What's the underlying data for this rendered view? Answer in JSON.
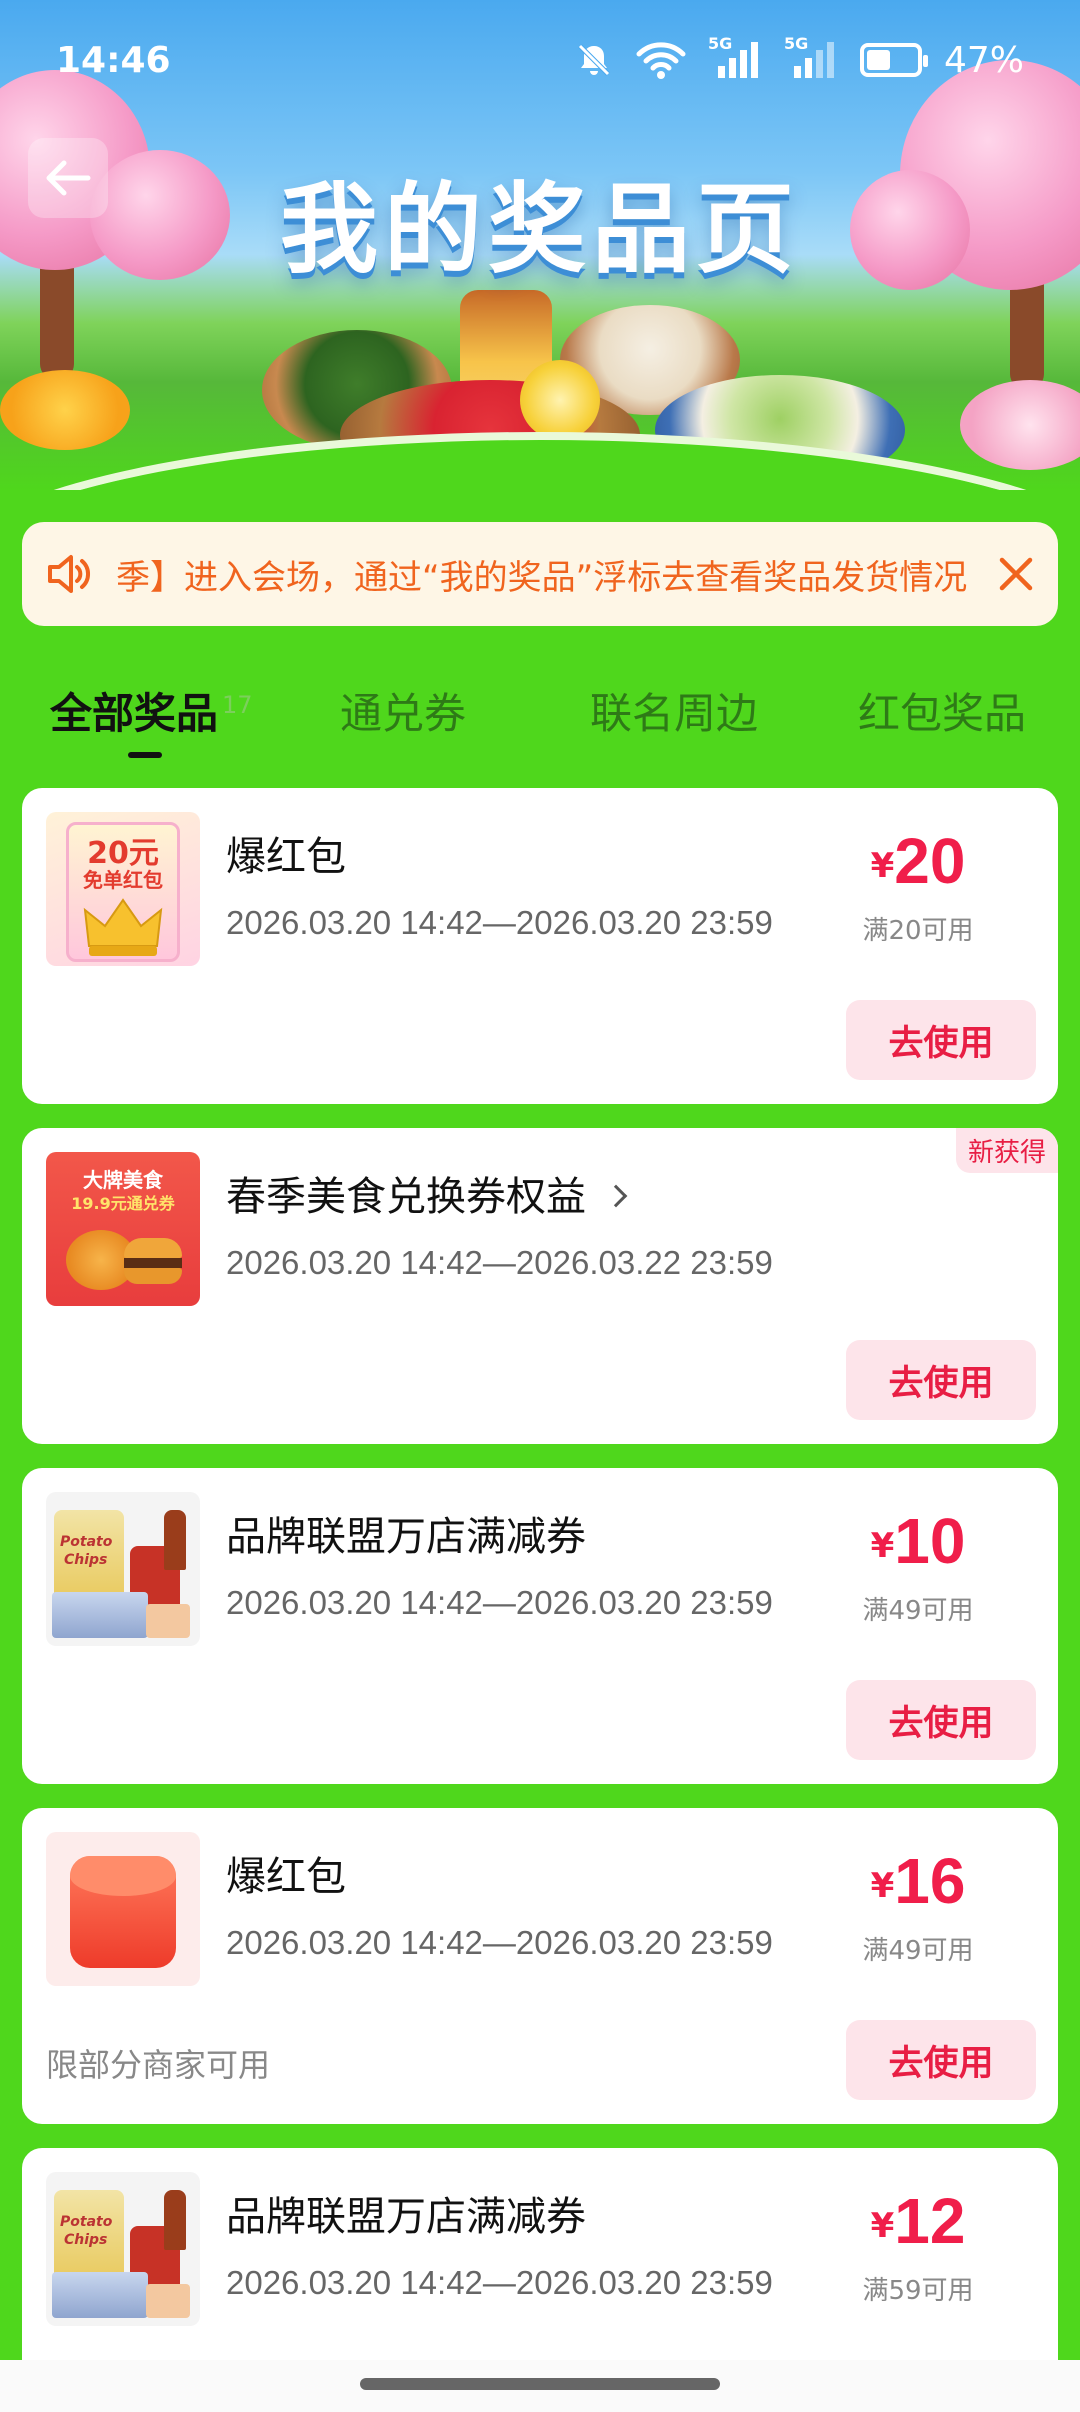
{
  "status_bar": {
    "time": "14:46",
    "network_1": "5G",
    "network_2": "5G",
    "battery": "47%",
    "battery_level": 0.47
  },
  "banner": {
    "title": "我的奖品页"
  },
  "notice": {
    "text": "季】进入会场，通过“我的奖品”浮标去查看奖品发货情况"
  },
  "tabs": [
    {
      "label": "全部奖品",
      "count": "17"
    },
    {
      "label": "通兑券"
    },
    {
      "label": "联名周边"
    },
    {
      "label": "红包奖品"
    }
  ],
  "prizes": [
    {
      "name": "爆红包",
      "date": "2026.03.20 14:42—2026.03.20 23:59",
      "yen": "¥",
      "amount": "20",
      "condition": "满20可用",
      "action": "去使用",
      "thumb_line1": "20元",
      "thumb_line2": "免单红包"
    },
    {
      "name": "春季美食兑换券权益",
      "date": "2026.03.20 14:42—2026.03.22 23:59",
      "tag": "新获得",
      "action": "去使用",
      "thumb_line1": "大牌美食",
      "thumb_line2": "19.9元通兑券"
    },
    {
      "name": "品牌联盟万店满减券",
      "date": "2026.03.20 14:42—2026.03.20 23:59",
      "yen": "¥",
      "amount": "10",
      "condition": "满49可用",
      "action": "去使用",
      "thumb_line1": "Potato",
      "thumb_line2": "Chips"
    },
    {
      "name": "爆红包",
      "date": "2026.03.20 14:42—2026.03.20 23:59",
      "yen": "¥",
      "amount": "16",
      "condition": "满49可用",
      "note": "限部分商家可用",
      "action": "去使用"
    },
    {
      "name": "品牌联盟万店满减券",
      "date": "2026.03.20 14:42—2026.03.20 23:59",
      "yen": "¥",
      "amount": "12",
      "condition": "满59可用",
      "thumb_line1": "Potato",
      "thumb_line2": "Chips"
    }
  ],
  "colors": {
    "page_bg": "#4fd71c",
    "price_red": "#f01e4a",
    "button_bg": "#fde4ea",
    "notice_orange": "#f0641e"
  },
  "icons": [
    "back-arrow-icon",
    "mute-icon",
    "wifi-icon",
    "signal-icon",
    "battery-icon",
    "speaker-icon",
    "close-icon",
    "chevron-right-icon"
  ]
}
